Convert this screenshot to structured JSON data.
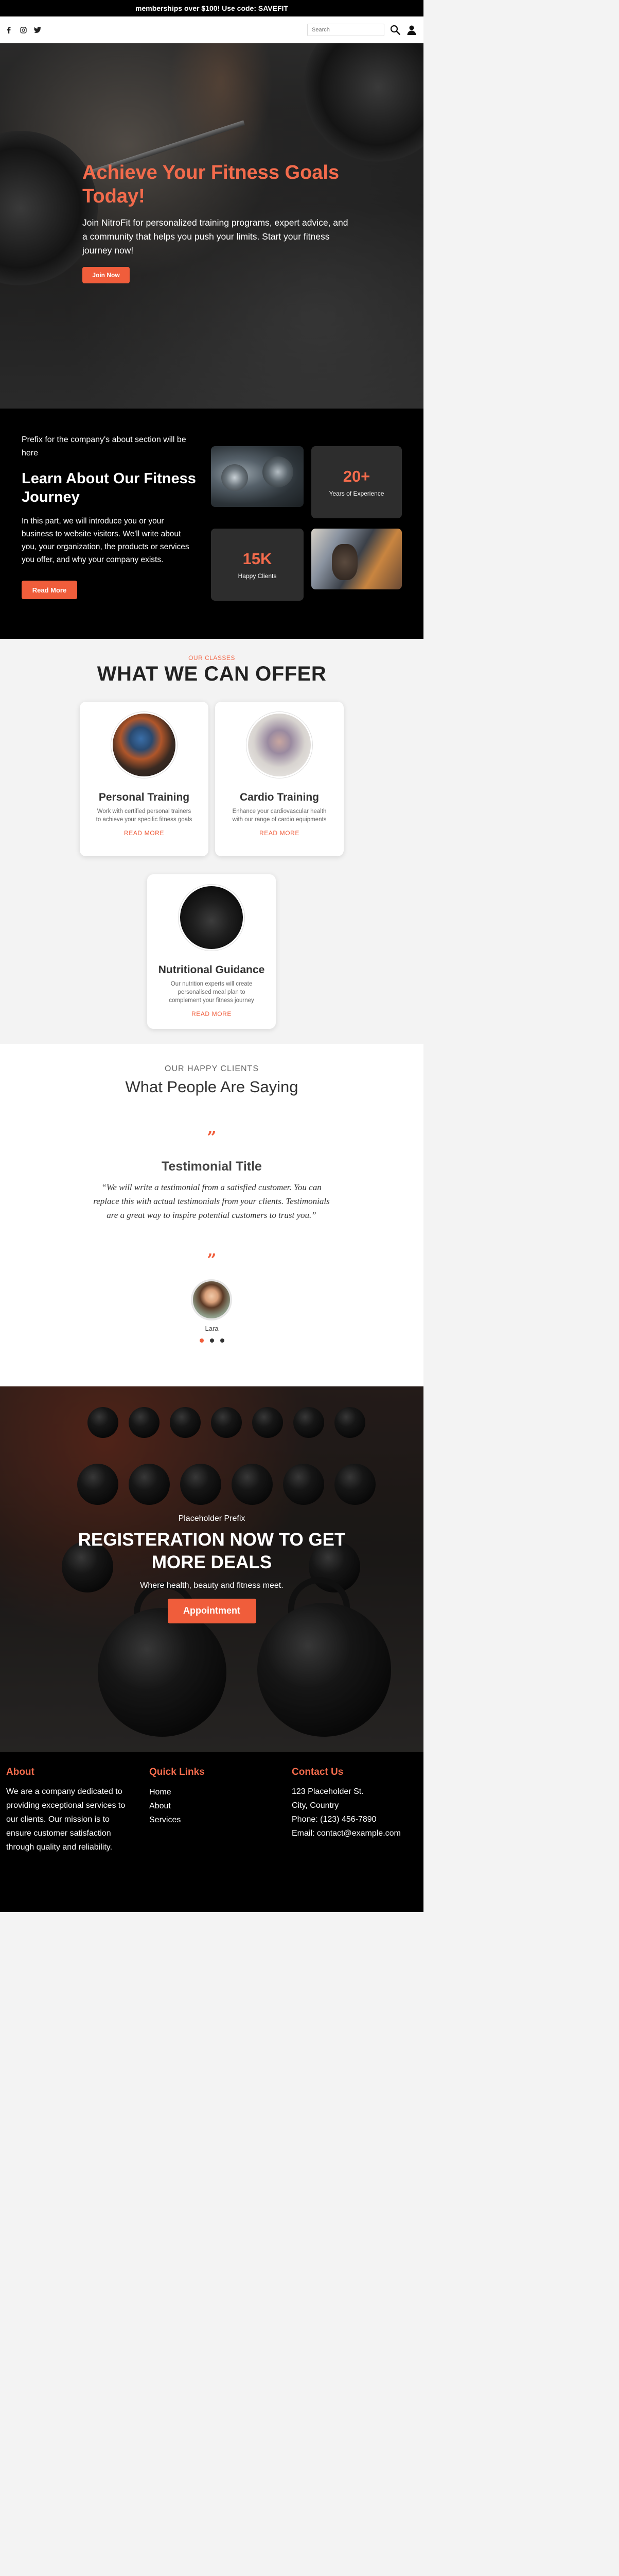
{
  "announcement": "memberships over $100! Use code: SAVEFIT",
  "header": {
    "social_icons": [
      "facebook-icon",
      "instagram-icon",
      "twitter-icon"
    ],
    "search_placeholder": "Search"
  },
  "hero": {
    "title": "Achieve Your Fitness Goals Today!",
    "text": "Join NitroFit for personalized training programs, expert advice, and a community that helps you push your limits. Start your fitness journey now!",
    "button": "Join Now"
  },
  "about": {
    "prefix": "Prefix for the company's about section will be here",
    "title": "Learn About Our Fitness Journey",
    "text": "In this part, we will introduce you or your business to website visitors. We'll write about you, your organization, the products or services you offer, and why your company exists.",
    "button": "Read More",
    "stats": [
      {
        "number": "20+",
        "label": "Years of Experience"
      },
      {
        "number": "15K",
        "label": "Happy Clients"
      }
    ]
  },
  "classes": {
    "eyebrow": "OUR CLASSES",
    "title": "WHAT WE CAN OFFER",
    "cards": [
      {
        "title": "Personal Training",
        "text": "Work with certified personal trainers to achieve your specific fitness goals",
        "link": "READ MORE"
      },
      {
        "title": "Cardio Training",
        "text": "Enhance your cardiovascular health with our range of cardio equipments",
        "link": "READ MORE"
      },
      {
        "title": "Nutritional Guidance",
        "text": "Our nutrition experts will create personalised meal plan to complement your fitness journey",
        "link": "READ MORE"
      }
    ]
  },
  "testimonials": {
    "eyebrow": "OUR HAPPY CLIENTS",
    "title": "What People Are Saying",
    "quote_mark": "”",
    "item_title": "Testimonial Title",
    "quote": "“We will write a testimonial from a satisfied customer. You can replace this with actual testimonials from your clients. Testimonials are a great way to inspire potential customers to trust you.”",
    "name": "Lara",
    "dots": 3,
    "active_dot": 0
  },
  "cta": {
    "prefix": "Placeholder Prefix",
    "title": "REGISTERATION NOW TO GET MORE DEALS",
    "subtitle": "Where health, beauty and fitness meet.",
    "button": "Appointment"
  },
  "footer": {
    "about_heading": "About",
    "about_text": "We are a company dedicated to providing exceptional services to our clients. Our mission is to ensure customer satisfaction through quality and reliability.",
    "links_heading": "Quick Links",
    "links": [
      "Home",
      "About",
      "Services"
    ],
    "contact_heading": "Contact Us",
    "contact": [
      "123 Placeholder St.",
      "City, Country",
      "Phone: (123) 456-7890",
      "Email: contact@example.com"
    ]
  },
  "colors": {
    "accent": "#f05d3b",
    "accent_text": "#f36b4c",
    "dark": "#000000",
    "card_bg": "#ffffff"
  }
}
